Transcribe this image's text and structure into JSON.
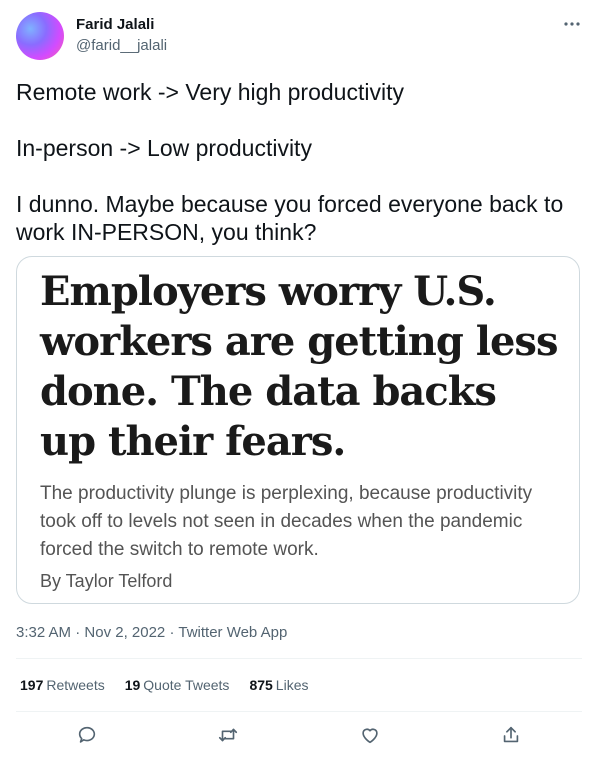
{
  "author": {
    "name": "Farid Jalali",
    "handle": "@farid__jalali"
  },
  "tweet": {
    "lines": [
      "Remote work -> Very high productivity",
      "In-person -> Low productivity",
      "I dunno. Maybe because you forced everyone back to work IN-PERSON, you think?"
    ]
  },
  "card": {
    "headline": "Employers worry U.S. workers are getting less done. The data backs up their fears.",
    "dek": "The productivity plunge is perplexing, because productivity took off to levels not seen in decades when the pandemic forced the switch to remote work.",
    "byline": "By Taylor Telford"
  },
  "meta": {
    "time": "3:32 AM",
    "date": "Nov 2, 2022",
    "source": "Twitter Web App",
    "separator": "·"
  },
  "stats": {
    "retweets_count": "197",
    "retweets_label": "Retweets",
    "quotes_count": "19",
    "quotes_label": "Quote Tweets",
    "likes_count": "875",
    "likes_label": "Likes"
  },
  "icons": {
    "more": "more-dots-icon",
    "reply": "reply-icon",
    "retweet": "retweet-icon",
    "like": "heart-icon",
    "share": "share-icon"
  },
  "colors": {
    "text": "#0f1419",
    "secondary": "#536471",
    "border": "#cfd9de",
    "divider": "#eff3f4"
  }
}
